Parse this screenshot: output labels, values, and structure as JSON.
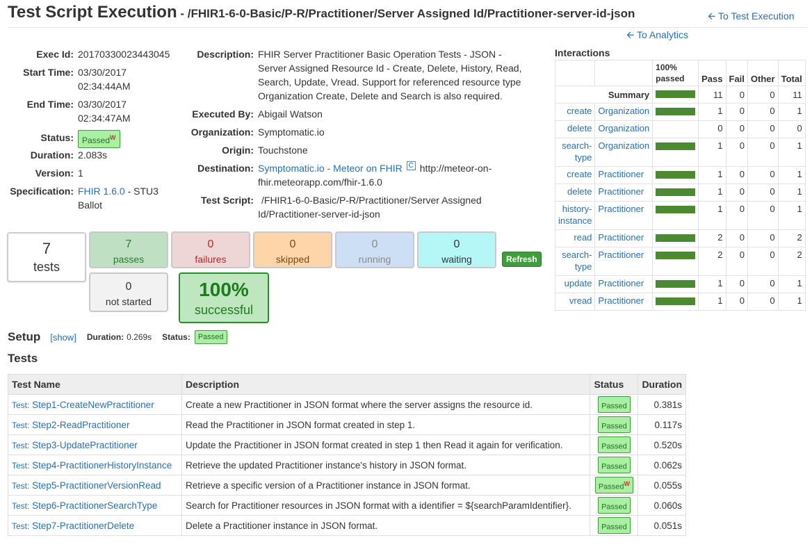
{
  "header": {
    "title": "Test Script Execution",
    "path": " - /FHIR1-6-0-Basic/P-R/Practitioner/Server Assigned Id/Practitioner-server-id-json",
    "to_test_execution": "To Test Execution",
    "to_analytics": "To Analytics"
  },
  "info": {
    "exec_id_label": "Exec Id:",
    "exec_id": "20170330023443045",
    "start_label": "Start Time:",
    "start_date": "03/30/2017",
    "start_time": "02:34:44AM",
    "end_label": "End Time:",
    "end_date": "03/30/2017",
    "end_time": "02:34:47AM",
    "status_label": "Status:",
    "status": "Passed",
    "status_warn": "W",
    "duration_label": "Duration:",
    "duration": "2.083s",
    "version_label": "Version:",
    "version": "1",
    "spec_label": "Specification:",
    "spec_link": "FHIR 1.6.0",
    "spec_rest": " - STU3",
    "spec_line2": "Ballot"
  },
  "details": {
    "desc_label": "Description:",
    "desc_lines": [
      "FHIR Server Practitioner Basic Operation Tests - JSON -",
      "Server Assigned Resource Id - Create, Delete, History, Read,",
      "Search, Update, Vread. Support for referenced resource type",
      "Organization Create, Delete and Search is also required."
    ],
    "executed_by_label": "Executed By:",
    "executed_by": "Abigail Watson",
    "org_label": "Organization:",
    "org": "Symptomatic.io",
    "origin_label": "Origin:",
    "origin": "Touchstone",
    "dest_label": "Destination:",
    "dest_link": "Symptomatic.io - Meteor on FHIR",
    "dest_icon": "C",
    "dest_url1": "http://meteor-on-",
    "dest_url2": "fhir.meteorapp.com/fhir-1.6.0",
    "script_label": "Test Script:",
    "script_line1": "/FHIR1-6-0-Basic/P-R/Practitioner/Server Assigned",
    "script_line2": "Id/Practitioner-server-id-json"
  },
  "stats": {
    "tests_n": "7",
    "tests_l": "tests",
    "passes_n": "7",
    "passes_l": "passes",
    "failures_n": "0",
    "failures_l": "failures",
    "skipped_n": "0",
    "skipped_l": "skipped",
    "running_n": "0",
    "running_l": "running",
    "waiting_n": "0",
    "waiting_l": "waiting",
    "notstarted_n": "0",
    "notstarted_l": "not started",
    "success_n": "100%",
    "success_l": "successful",
    "refresh": "Refresh"
  },
  "setup": {
    "title": "Setup",
    "show": "[show]",
    "duration_label": "Duration:",
    "duration": "0.269s",
    "status_label": "Status:",
    "status": "Passed"
  },
  "tests": {
    "title": "Tests",
    "headers": [
      "Test Name",
      "Description",
      "Status",
      "Duration"
    ],
    "rows": [
      {
        "prefix": "Test:",
        "name": "Step1-CreateNewPractitioner",
        "desc": "Create a new Practitioner in JSON format where the server assigns the resource id.",
        "status": "Passed",
        "warn": "",
        "duration": "0.381s"
      },
      {
        "prefix": "Test:",
        "name": "Step2-ReadPractitioner",
        "desc": "Read the Practitioner in JSON format created in step 1.",
        "status": "Passed",
        "warn": "",
        "duration": "0.117s"
      },
      {
        "prefix": "Test:",
        "name": "Step3-UpdatePractitioner",
        "desc": "Update the Practitioner in JSON format created in step 1 then Read it again for verification.",
        "status": "Passed",
        "warn": "",
        "duration": "0.520s"
      },
      {
        "prefix": "Test:",
        "name": "Step4-PractitionerHistoryInstance",
        "desc": "Retrieve the updated Practitioner instance's history in JSON format.",
        "status": "Passed",
        "warn": "",
        "duration": "0.062s"
      },
      {
        "prefix": "Test:",
        "name": "Step5-PractitionerVersionRead",
        "desc": "Retrieve a specific version of a Practitioner instance in JSON format.",
        "status": "Passed",
        "warn": "W",
        "duration": "0.055s"
      },
      {
        "prefix": "Test:",
        "name": "Step6-PractitionerSearchType",
        "desc": "Search for Practitioner resources in JSON format with a identifier = ${searchParamIdentifier}.",
        "status": "Passed",
        "warn": "",
        "duration": "0.060s"
      },
      {
        "prefix": "Test:",
        "name": "Step7-PractitionerDelete",
        "desc": "Delete a Practitioner instance in JSON format.",
        "status": "Passed",
        "warn": "",
        "duration": "0.051s"
      }
    ]
  },
  "interactions": {
    "title": "Interactions",
    "headers": {
      "pct": "100% passed",
      "pass": "Pass",
      "fail": "Fail",
      "other": "Other",
      "total": "Total"
    },
    "summary_label": "Summary",
    "summary": {
      "pass": "11",
      "fail": "0",
      "other": "0",
      "total": "11",
      "pct": 100
    },
    "rows": [
      {
        "op1": "create",
        "op2": "",
        "res": "Organization",
        "pct": 100,
        "pass": "1",
        "fail": "0",
        "other": "0",
        "total": "1"
      },
      {
        "op1": "delete",
        "op2": "",
        "res": "Organization",
        "pct": 0,
        "pass": "0",
        "fail": "0",
        "other": "0",
        "total": "0"
      },
      {
        "op1": "search-",
        "op2": "type",
        "res": "Organization",
        "pct": 100,
        "pass": "1",
        "fail": "0",
        "other": "0",
        "total": "1"
      },
      {
        "op1": "create",
        "op2": "",
        "res": "Practitioner",
        "pct": 100,
        "pass": "1",
        "fail": "0",
        "other": "0",
        "total": "1"
      },
      {
        "op1": "delete",
        "op2": "",
        "res": "Practitioner",
        "pct": 100,
        "pass": "1",
        "fail": "0",
        "other": "0",
        "total": "1"
      },
      {
        "op1": "history-",
        "op2": "instance",
        "res": "Practitioner",
        "pct": 100,
        "pass": "1",
        "fail": "0",
        "other": "0",
        "total": "1"
      },
      {
        "op1": "read",
        "op2": "",
        "res": "Practitioner",
        "pct": 100,
        "pass": "2",
        "fail": "0",
        "other": "0",
        "total": "2"
      },
      {
        "op1": "search-",
        "op2": "type",
        "res": "Practitioner",
        "pct": 100,
        "pass": "2",
        "fail": "0",
        "other": "0",
        "total": "2"
      },
      {
        "op1": "update",
        "op2": "",
        "res": "Practitioner",
        "pct": 100,
        "pass": "1",
        "fail": "0",
        "other": "0",
        "total": "1"
      },
      {
        "op1": "vread",
        "op2": "",
        "res": "Practitioner",
        "pct": 100,
        "pass": "1",
        "fail": "0",
        "other": "0",
        "total": "1"
      }
    ]
  },
  "colors": {
    "link": "#2a6fb0",
    "pass_green": "#a9f0a3",
    "bar_green": "#4b8a30"
  }
}
